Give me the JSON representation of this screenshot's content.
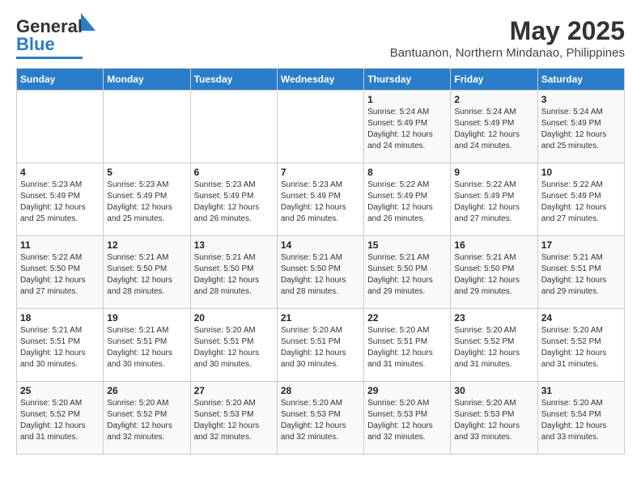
{
  "header": {
    "logo_line1": "General",
    "logo_line2": "Blue",
    "title": "May 2025",
    "subtitle": "Bantuanon, Northern Mindanao, Philippines"
  },
  "days_of_week": [
    "Sunday",
    "Monday",
    "Tuesday",
    "Wednesday",
    "Thursday",
    "Friday",
    "Saturday"
  ],
  "weeks": [
    [
      {
        "day": "",
        "info": ""
      },
      {
        "day": "",
        "info": ""
      },
      {
        "day": "",
        "info": ""
      },
      {
        "day": "",
        "info": ""
      },
      {
        "day": "1",
        "info": "Sunrise: 5:24 AM\nSunset: 5:49 PM\nDaylight: 12 hours\nand 24 minutes."
      },
      {
        "day": "2",
        "info": "Sunrise: 5:24 AM\nSunset: 5:49 PM\nDaylight: 12 hours\nand 24 minutes."
      },
      {
        "day": "3",
        "info": "Sunrise: 5:24 AM\nSunset: 5:49 PM\nDaylight: 12 hours\nand 25 minutes."
      }
    ],
    [
      {
        "day": "4",
        "info": "Sunrise: 5:23 AM\nSunset: 5:49 PM\nDaylight: 12 hours\nand 25 minutes."
      },
      {
        "day": "5",
        "info": "Sunrise: 5:23 AM\nSunset: 5:49 PM\nDaylight: 12 hours\nand 25 minutes."
      },
      {
        "day": "6",
        "info": "Sunrise: 5:23 AM\nSunset: 5:49 PM\nDaylight: 12 hours\nand 26 minutes."
      },
      {
        "day": "7",
        "info": "Sunrise: 5:23 AM\nSunset: 5:49 PM\nDaylight: 12 hours\nand 26 minutes."
      },
      {
        "day": "8",
        "info": "Sunrise: 5:22 AM\nSunset: 5:49 PM\nDaylight: 12 hours\nand 26 minutes."
      },
      {
        "day": "9",
        "info": "Sunrise: 5:22 AM\nSunset: 5:49 PM\nDaylight: 12 hours\nand 27 minutes."
      },
      {
        "day": "10",
        "info": "Sunrise: 5:22 AM\nSunset: 5:49 PM\nDaylight: 12 hours\nand 27 minutes."
      }
    ],
    [
      {
        "day": "11",
        "info": "Sunrise: 5:22 AM\nSunset: 5:50 PM\nDaylight: 12 hours\nand 27 minutes."
      },
      {
        "day": "12",
        "info": "Sunrise: 5:21 AM\nSunset: 5:50 PM\nDaylight: 12 hours\nand 28 minutes."
      },
      {
        "day": "13",
        "info": "Sunrise: 5:21 AM\nSunset: 5:50 PM\nDaylight: 12 hours\nand 28 minutes."
      },
      {
        "day": "14",
        "info": "Sunrise: 5:21 AM\nSunset: 5:50 PM\nDaylight: 12 hours\nand 28 minutes."
      },
      {
        "day": "15",
        "info": "Sunrise: 5:21 AM\nSunset: 5:50 PM\nDaylight: 12 hours\nand 29 minutes."
      },
      {
        "day": "16",
        "info": "Sunrise: 5:21 AM\nSunset: 5:50 PM\nDaylight: 12 hours\nand 29 minutes."
      },
      {
        "day": "17",
        "info": "Sunrise: 5:21 AM\nSunset: 5:51 PM\nDaylight: 12 hours\nand 29 minutes."
      }
    ],
    [
      {
        "day": "18",
        "info": "Sunrise: 5:21 AM\nSunset: 5:51 PM\nDaylight: 12 hours\nand 30 minutes."
      },
      {
        "day": "19",
        "info": "Sunrise: 5:21 AM\nSunset: 5:51 PM\nDaylight: 12 hours\nand 30 minutes."
      },
      {
        "day": "20",
        "info": "Sunrise: 5:20 AM\nSunset: 5:51 PM\nDaylight: 12 hours\nand 30 minutes."
      },
      {
        "day": "21",
        "info": "Sunrise: 5:20 AM\nSunset: 5:51 PM\nDaylight: 12 hours\nand 30 minutes."
      },
      {
        "day": "22",
        "info": "Sunrise: 5:20 AM\nSunset: 5:51 PM\nDaylight: 12 hours\nand 31 minutes."
      },
      {
        "day": "23",
        "info": "Sunrise: 5:20 AM\nSunset: 5:52 PM\nDaylight: 12 hours\nand 31 minutes."
      },
      {
        "day": "24",
        "info": "Sunrise: 5:20 AM\nSunset: 5:52 PM\nDaylight: 12 hours\nand 31 minutes."
      }
    ],
    [
      {
        "day": "25",
        "info": "Sunrise: 5:20 AM\nSunset: 5:52 PM\nDaylight: 12 hours\nand 31 minutes."
      },
      {
        "day": "26",
        "info": "Sunrise: 5:20 AM\nSunset: 5:52 PM\nDaylight: 12 hours\nand 32 minutes."
      },
      {
        "day": "27",
        "info": "Sunrise: 5:20 AM\nSunset: 5:53 PM\nDaylight: 12 hours\nand 32 minutes."
      },
      {
        "day": "28",
        "info": "Sunrise: 5:20 AM\nSunset: 5:53 PM\nDaylight: 12 hours\nand 32 minutes."
      },
      {
        "day": "29",
        "info": "Sunrise: 5:20 AM\nSunset: 5:53 PM\nDaylight: 12 hours\nand 32 minutes."
      },
      {
        "day": "30",
        "info": "Sunrise: 5:20 AM\nSunset: 5:53 PM\nDaylight: 12 hours\nand 33 minutes."
      },
      {
        "day": "31",
        "info": "Sunrise: 5:20 AM\nSunset: 5:54 PM\nDaylight: 12 hours\nand 33 minutes."
      }
    ]
  ]
}
